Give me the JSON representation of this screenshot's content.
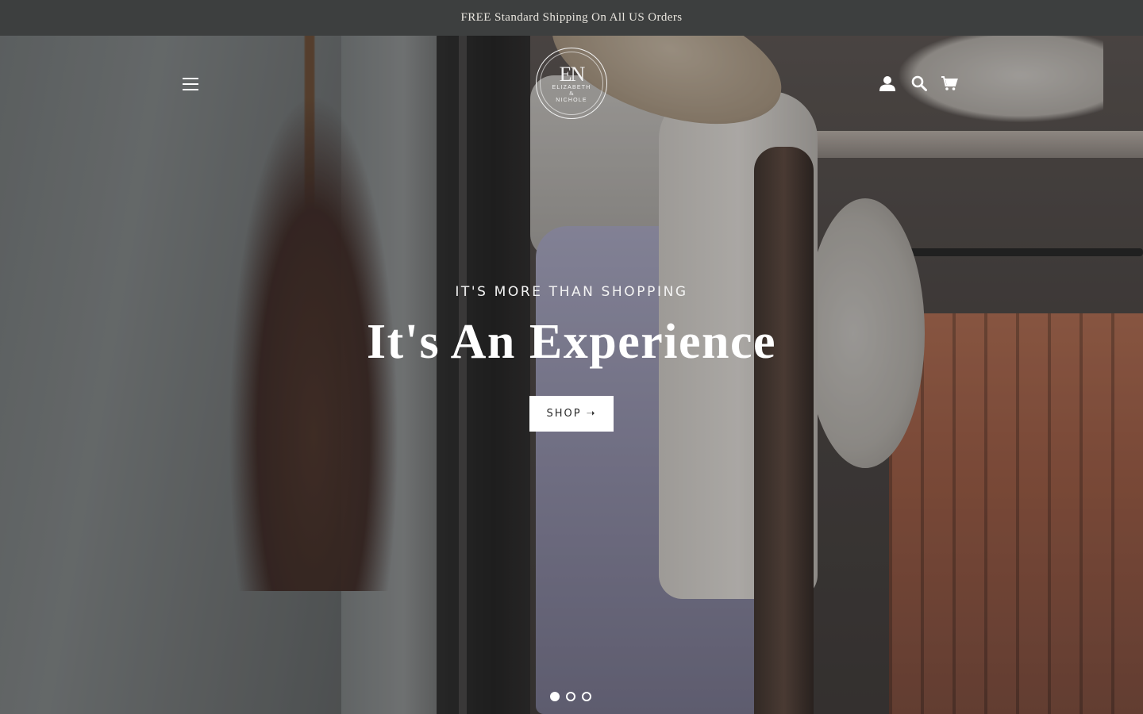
{
  "announcement": {
    "text": "FREE Standard Shipping On All US Orders"
  },
  "header": {
    "logo": {
      "monogram": "EN",
      "line1": "ELIZABETH",
      "amp": "&",
      "line2": "NICHOLE"
    },
    "icons": {
      "menu": "hamburger-menu-icon",
      "account": "account-icon",
      "search": "search-icon",
      "cart": "cart-icon"
    }
  },
  "hero": {
    "subheading": "IT'S MORE THAN SHOPPING",
    "title": "It's An Experience",
    "button_label": "SHOP",
    "button_arrow": "➝",
    "slides": {
      "count": 3,
      "active_index": 0
    }
  },
  "colors": {
    "announcement_bg": "#3d3f3f",
    "announcement_text": "#e9e6df",
    "hero_text": "#ffffff",
    "button_bg": "#ffffff",
    "button_text": "#2c2c2c"
  }
}
